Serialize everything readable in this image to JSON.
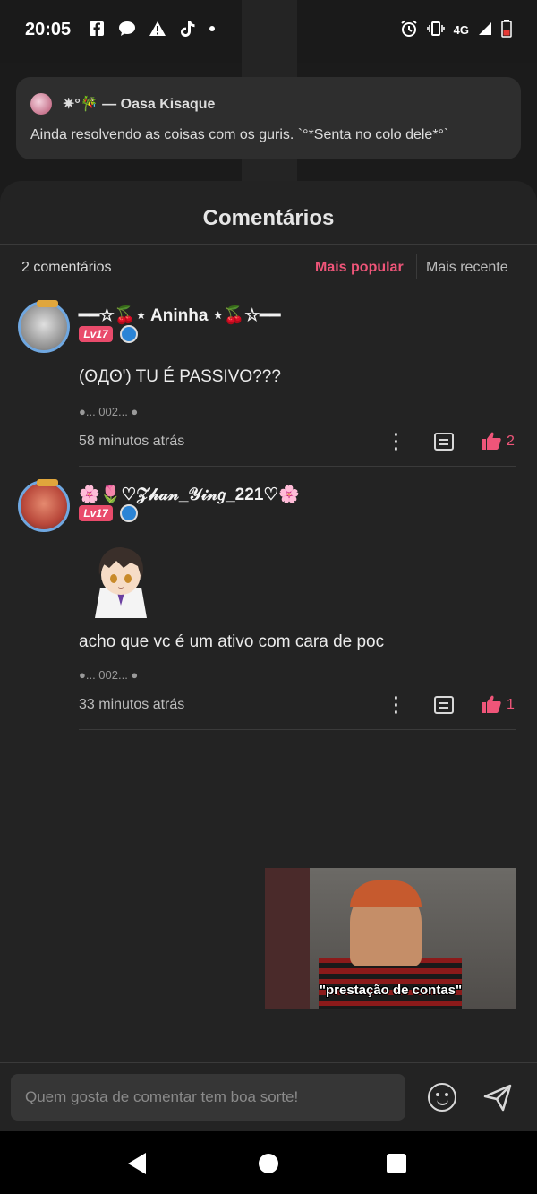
{
  "status_bar": {
    "time": "20:05",
    "network": "4G",
    "app_icons": [
      "facebook-icon",
      "chat-icon",
      "warning-icon",
      "tiktok-icon"
    ]
  },
  "notification": {
    "name": "✷°🎋 — Oasa Kisaque",
    "text": "Ainda resolvendo as coisas com os guris. `°*Senta no colo dele*°`"
  },
  "sheet": {
    "title": "Comentários",
    "count": "2 comentários",
    "sort_popular": "Mais popular",
    "sort_recent": "Mais recente"
  },
  "comments": [
    {
      "name": "━━☆🍒⋆ Aninha ⋆🍒☆━━",
      "level": "Lv17",
      "text": "(ʘДʘ') TU É PASSIVO???",
      "meta": "●... 002... ●",
      "time": "58 minutos atrás",
      "likes": "2"
    },
    {
      "name": "🌸🌷♡𝒵𝒽𝒶𝓃_𝒴𝒾𝓃𝑔_221♡🌸",
      "level": "Lv17",
      "text": "acho que vc é um ativo com cara de poc",
      "meta": "●... 002... ●",
      "time": "33 minutos atrás",
      "likes": "1"
    }
  ],
  "video": {
    "caption": "\"prestação de contas\""
  },
  "input": {
    "placeholder": "Quem gosta de comentar tem boa sorte!"
  },
  "colors": {
    "accent": "#ef5579",
    "level_badge": "#e94b6b",
    "background": "#232323"
  }
}
